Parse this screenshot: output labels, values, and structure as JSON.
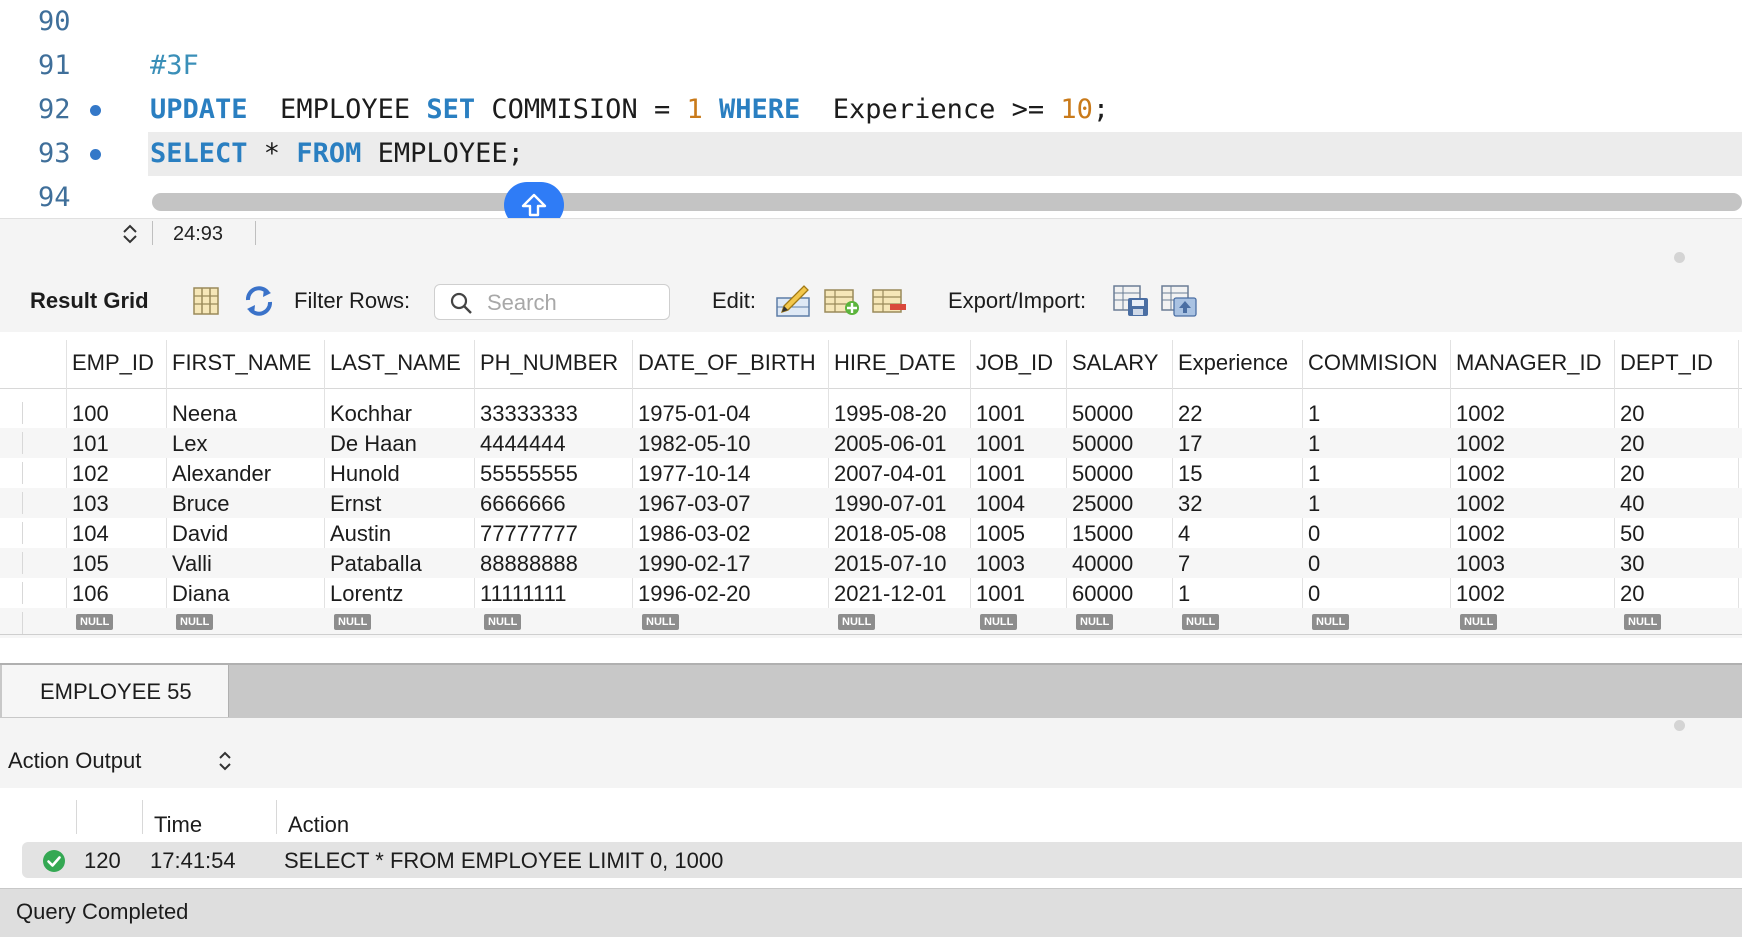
{
  "editor": {
    "lines": [
      {
        "number": "90",
        "tokens": [],
        "marker": false
      },
      {
        "number": "91",
        "tokens": [
          {
            "t": "#3F",
            "c": "cmt"
          }
        ],
        "marker": false
      },
      {
        "number": "92",
        "marker": true,
        "tokens": [
          {
            "t": "UPDATE",
            "c": "kw"
          },
          {
            "t": "  EMPLOYEE ",
            "c": "plain"
          },
          {
            "t": "SET",
            "c": "kw"
          },
          {
            "t": " COMMISION = ",
            "c": "plain"
          },
          {
            "t": "1",
            "c": "num"
          },
          {
            "t": " ",
            "c": "plain"
          },
          {
            "t": "WHERE",
            "c": "kw"
          },
          {
            "t": "  Experience >= ",
            "c": "plain"
          },
          {
            "t": "10",
            "c": "num"
          },
          {
            "t": ";",
            "c": "plain"
          }
        ]
      },
      {
        "number": "93",
        "marker": true,
        "current": true,
        "tokens": [
          {
            "t": "SELECT",
            "c": "kw"
          },
          {
            "t": " * ",
            "c": "plain"
          },
          {
            "t": "FROM",
            "c": "kw"
          },
          {
            "t": " EMPLOYEE;",
            "c": "plain"
          }
        ]
      },
      {
        "number": "94",
        "tokens": [],
        "marker": false
      }
    ],
    "cursor_position": "24:93"
  },
  "result_toolbar": {
    "result_grid_label": "Result Grid",
    "filter_rows_label": "Filter Rows:",
    "search_placeholder": "Search",
    "edit_label": "Edit:",
    "export_import_label": "Export/Import:"
  },
  "grid": {
    "columns": [
      "EMP_ID",
      "FIRST_NAME",
      "LAST_NAME",
      "PH_NUMBER",
      "DATE_OF_BIRTH",
      "HIRE_DATE",
      "JOB_ID",
      "SALARY",
      "Experience",
      "COMMISION",
      "MANAGER_ID",
      "DEPT_ID"
    ],
    "rows": [
      [
        "100",
        "Neena",
        "Kochhar",
        "33333333",
        "1975-01-04",
        "1995-08-20",
        "1001",
        "50000",
        "22",
        "1",
        "1002",
        "20"
      ],
      [
        "101",
        "Lex",
        "De Haan",
        "4444444",
        "1982-05-10",
        "2005-06-01",
        "1001",
        "50000",
        "17",
        "1",
        "1002",
        "20"
      ],
      [
        "102",
        "Alexander",
        "Hunold",
        "55555555",
        "1977-10-14",
        "2007-04-01",
        "1001",
        "50000",
        "15",
        "1",
        "1002",
        "20"
      ],
      [
        "103",
        "Bruce",
        "Ernst",
        "6666666",
        "1967-03-07",
        "1990-07-01",
        "1004",
        "25000",
        "32",
        "1",
        "1002",
        "40"
      ],
      [
        "104",
        "David",
        "Austin",
        "77777777",
        "1986-03-02",
        "2018-05-08",
        "1005",
        "15000",
        "4",
        "0",
        "1002",
        "50"
      ],
      [
        "105",
        "Valli",
        "Pataballa",
        "88888888",
        "1990-02-17",
        "2015-07-10",
        "1003",
        "40000",
        "7",
        "0",
        "1003",
        "30"
      ],
      [
        "106",
        "Diana",
        "Lorentz",
        "11111111",
        "1996-02-20",
        "2021-12-01",
        "1001",
        "60000",
        "1",
        "0",
        "1002",
        "20"
      ]
    ],
    "null_label": "NULL"
  },
  "result_tabs": [
    {
      "label": "EMPLOYEE 55"
    }
  ],
  "output": {
    "selector_label": "Action Output",
    "headers": {
      "time": "Time",
      "action": "Action"
    },
    "rows": [
      {
        "status": "success",
        "num": "120",
        "time": "17:41:54",
        "action": "SELECT * FROM EMPLOYEE LIMIT 0, 1000"
      }
    ]
  },
  "status_bar": {
    "message": "Query Completed"
  },
  "colors": {
    "keyword": "#2a7fc1",
    "number": "#c97a1a",
    "comment": "#3a8fb8",
    "accent": "#2f7cf6",
    "success": "#34a853"
  }
}
